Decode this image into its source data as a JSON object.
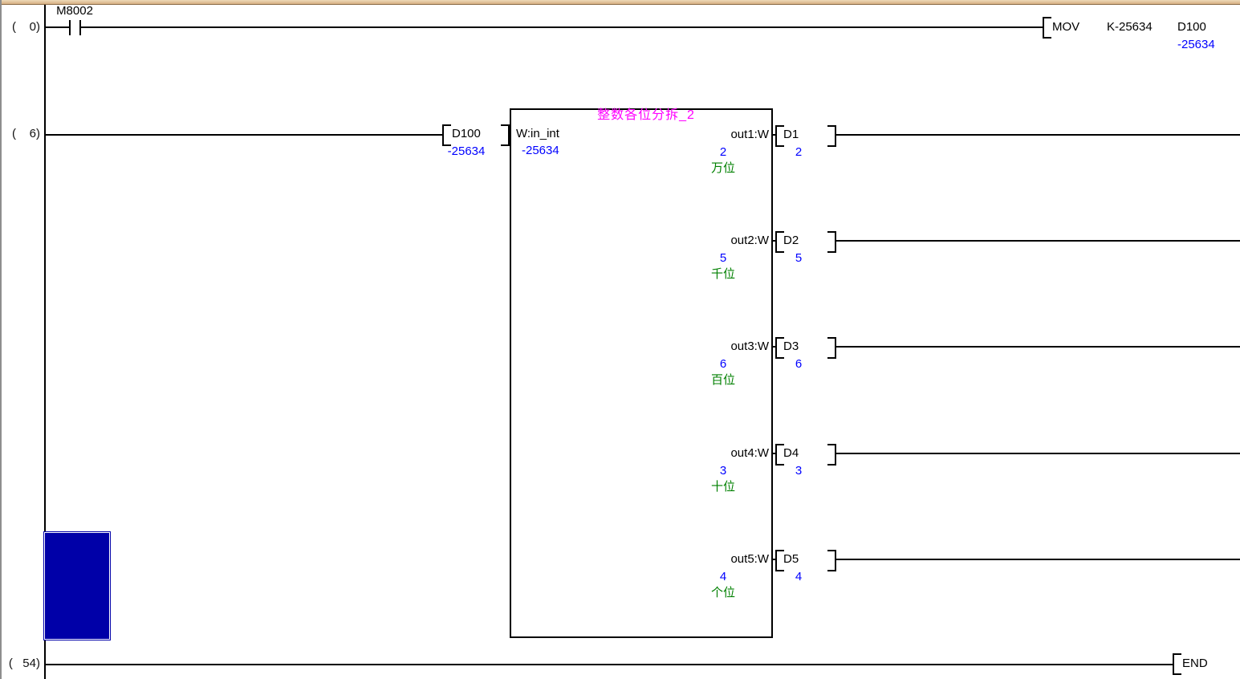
{
  "colors": {
    "wire": "#000000",
    "monitor_value_blue": "#0000ff",
    "comment_green": "#008000",
    "fb_title_magenta": "#ff00ff",
    "cursor_blue": "#0000a8",
    "top_border_tan": "#d7b083"
  },
  "rung0": {
    "step": "(    0)",
    "contact_label": "M8002",
    "instruction": {
      "mnemonic": "MOV",
      "operand1": "K-25634",
      "operand2": "D100",
      "operand2_value": "-25634"
    }
  },
  "rung6": {
    "step": "(    6)",
    "input_param": {
      "device": "D100",
      "value": "-25634"
    },
    "fb": {
      "title": "整数各位分拆_2",
      "input_label": "W:in_int",
      "input_value": "-25634",
      "outputs": [
        {
          "label": "out1:W",
          "value": "2",
          "comment": "万位",
          "device": "D1",
          "device_value": "2"
        },
        {
          "label": "out2:W",
          "value": "5",
          "comment": "千位",
          "device": "D2",
          "device_value": "5"
        },
        {
          "label": "out3:W",
          "value": "6",
          "comment": "百位",
          "device": "D3",
          "device_value": "6"
        },
        {
          "label": "out4:W",
          "value": "3",
          "comment": "十位",
          "device": "D4",
          "device_value": "3"
        },
        {
          "label": "out5:W",
          "value": "4",
          "comment": "个位",
          "device": "D5",
          "device_value": "4"
        }
      ]
    }
  },
  "rung54": {
    "step": "(   54)",
    "instruction": "END"
  }
}
